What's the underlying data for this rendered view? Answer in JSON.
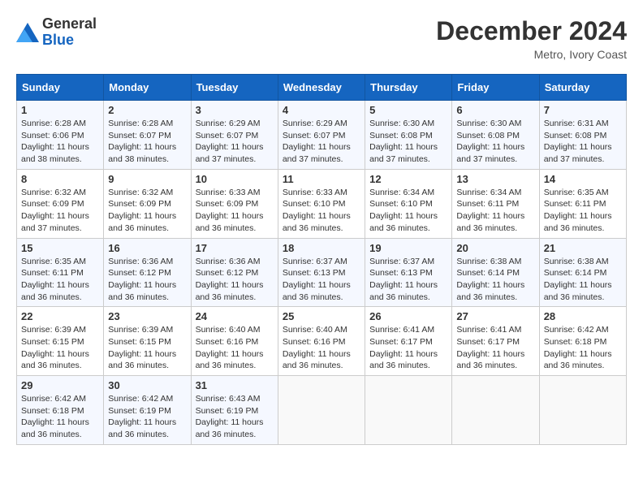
{
  "header": {
    "logo_line1": "General",
    "logo_line2": "Blue",
    "month_title": "December 2024",
    "location": "Metro, Ivory Coast"
  },
  "days_of_week": [
    "Sunday",
    "Monday",
    "Tuesday",
    "Wednesday",
    "Thursday",
    "Friday",
    "Saturday"
  ],
  "weeks": [
    [
      {
        "day": "1",
        "sunrise": "6:28 AM",
        "sunset": "6:06 PM",
        "daylight": "11 hours and 38 minutes."
      },
      {
        "day": "2",
        "sunrise": "6:28 AM",
        "sunset": "6:07 PM",
        "daylight": "11 hours and 38 minutes."
      },
      {
        "day": "3",
        "sunrise": "6:29 AM",
        "sunset": "6:07 PM",
        "daylight": "11 hours and 37 minutes."
      },
      {
        "day": "4",
        "sunrise": "6:29 AM",
        "sunset": "6:07 PM",
        "daylight": "11 hours and 37 minutes."
      },
      {
        "day": "5",
        "sunrise": "6:30 AM",
        "sunset": "6:08 PM",
        "daylight": "11 hours and 37 minutes."
      },
      {
        "day": "6",
        "sunrise": "6:30 AM",
        "sunset": "6:08 PM",
        "daylight": "11 hours and 37 minutes."
      },
      {
        "day": "7",
        "sunrise": "6:31 AM",
        "sunset": "6:08 PM",
        "daylight": "11 hours and 37 minutes."
      }
    ],
    [
      {
        "day": "8",
        "sunrise": "6:32 AM",
        "sunset": "6:09 PM",
        "daylight": "11 hours and 37 minutes."
      },
      {
        "day": "9",
        "sunrise": "6:32 AM",
        "sunset": "6:09 PM",
        "daylight": "11 hours and 36 minutes."
      },
      {
        "day": "10",
        "sunrise": "6:33 AM",
        "sunset": "6:09 PM",
        "daylight": "11 hours and 36 minutes."
      },
      {
        "day": "11",
        "sunrise": "6:33 AM",
        "sunset": "6:10 PM",
        "daylight": "11 hours and 36 minutes."
      },
      {
        "day": "12",
        "sunrise": "6:34 AM",
        "sunset": "6:10 PM",
        "daylight": "11 hours and 36 minutes."
      },
      {
        "day": "13",
        "sunrise": "6:34 AM",
        "sunset": "6:11 PM",
        "daylight": "11 hours and 36 minutes."
      },
      {
        "day": "14",
        "sunrise": "6:35 AM",
        "sunset": "6:11 PM",
        "daylight": "11 hours and 36 minutes."
      }
    ],
    [
      {
        "day": "15",
        "sunrise": "6:35 AM",
        "sunset": "6:11 PM",
        "daylight": "11 hours and 36 minutes."
      },
      {
        "day": "16",
        "sunrise": "6:36 AM",
        "sunset": "6:12 PM",
        "daylight": "11 hours and 36 minutes."
      },
      {
        "day": "17",
        "sunrise": "6:36 AM",
        "sunset": "6:12 PM",
        "daylight": "11 hours and 36 minutes."
      },
      {
        "day": "18",
        "sunrise": "6:37 AM",
        "sunset": "6:13 PM",
        "daylight": "11 hours and 36 minutes."
      },
      {
        "day": "19",
        "sunrise": "6:37 AM",
        "sunset": "6:13 PM",
        "daylight": "11 hours and 36 minutes."
      },
      {
        "day": "20",
        "sunrise": "6:38 AM",
        "sunset": "6:14 PM",
        "daylight": "11 hours and 36 minutes."
      },
      {
        "day": "21",
        "sunrise": "6:38 AM",
        "sunset": "6:14 PM",
        "daylight": "11 hours and 36 minutes."
      }
    ],
    [
      {
        "day": "22",
        "sunrise": "6:39 AM",
        "sunset": "6:15 PM",
        "daylight": "11 hours and 36 minutes."
      },
      {
        "day": "23",
        "sunrise": "6:39 AM",
        "sunset": "6:15 PM",
        "daylight": "11 hours and 36 minutes."
      },
      {
        "day": "24",
        "sunrise": "6:40 AM",
        "sunset": "6:16 PM",
        "daylight": "11 hours and 36 minutes."
      },
      {
        "day": "25",
        "sunrise": "6:40 AM",
        "sunset": "6:16 PM",
        "daylight": "11 hours and 36 minutes."
      },
      {
        "day": "26",
        "sunrise": "6:41 AM",
        "sunset": "6:17 PM",
        "daylight": "11 hours and 36 minutes."
      },
      {
        "day": "27",
        "sunrise": "6:41 AM",
        "sunset": "6:17 PM",
        "daylight": "11 hours and 36 minutes."
      },
      {
        "day": "28",
        "sunrise": "6:42 AM",
        "sunset": "6:18 PM",
        "daylight": "11 hours and 36 minutes."
      }
    ],
    [
      {
        "day": "29",
        "sunrise": "6:42 AM",
        "sunset": "6:18 PM",
        "daylight": "11 hours and 36 minutes."
      },
      {
        "day": "30",
        "sunrise": "6:42 AM",
        "sunset": "6:19 PM",
        "daylight": "11 hours and 36 minutes."
      },
      {
        "day": "31",
        "sunrise": "6:43 AM",
        "sunset": "6:19 PM",
        "daylight": "11 hours and 36 minutes."
      },
      null,
      null,
      null,
      null
    ]
  ]
}
